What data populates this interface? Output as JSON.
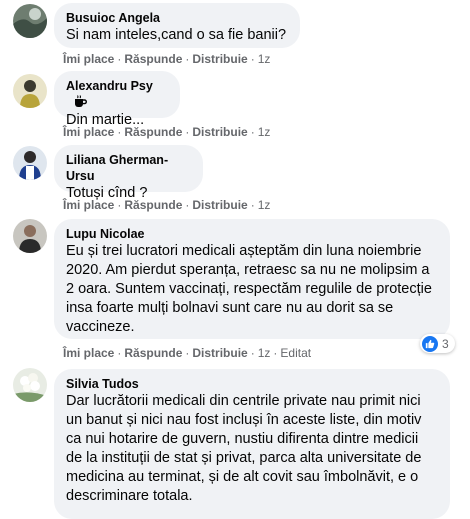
{
  "actions": {
    "like": "Îmi place",
    "reply": "Răspunde",
    "share": "Distribuie",
    "separator": "·"
  },
  "comments": [
    {
      "author": "Busuioc Angela",
      "text": "Si nam inteles,cand o sa fie banii?",
      "time": "1z"
    },
    {
      "author": "Alexandru Psy",
      "author_icon": "coffee-cup-icon",
      "text": "Din martie...",
      "time": "1z"
    },
    {
      "author": "Liliana Gherman-Ursu",
      "text": "Totuși cînd ?",
      "time": "1z"
    },
    {
      "author": "Lupu Nicolae",
      "text": "Eu și trei lucratori medicali așteptăm din luna noiembrie 2020. Am pierdut speranța, retraesc sa nu ne molipsim a 2 oara. Suntem vaccinați, respectăm regulile de protecție insa foarte mulți bolnavi sunt care nu au dorit sa se vaccineze.",
      "time": "1z",
      "edited": "Editat",
      "reactions": {
        "icon": "like-icon",
        "count": "3"
      }
    },
    {
      "author": "Silvia Tudos",
      "text": "Dar lucrătorii medicali din centrile private nau primit nici un banut și nici nau fost incluși în aceste liste, din motiv ca nui hotarire de guvern, nustiu difirenta dintre medicii de la instituții de stat și privat, parca alta universitate de medicina au terminat, și de alt covit sau îmbolnăvit, e o descriminare totala."
    }
  ],
  "colors": {
    "bubble": "#f0f2f5",
    "meta": "#65676b",
    "like_blue": "#1877f2"
  }
}
